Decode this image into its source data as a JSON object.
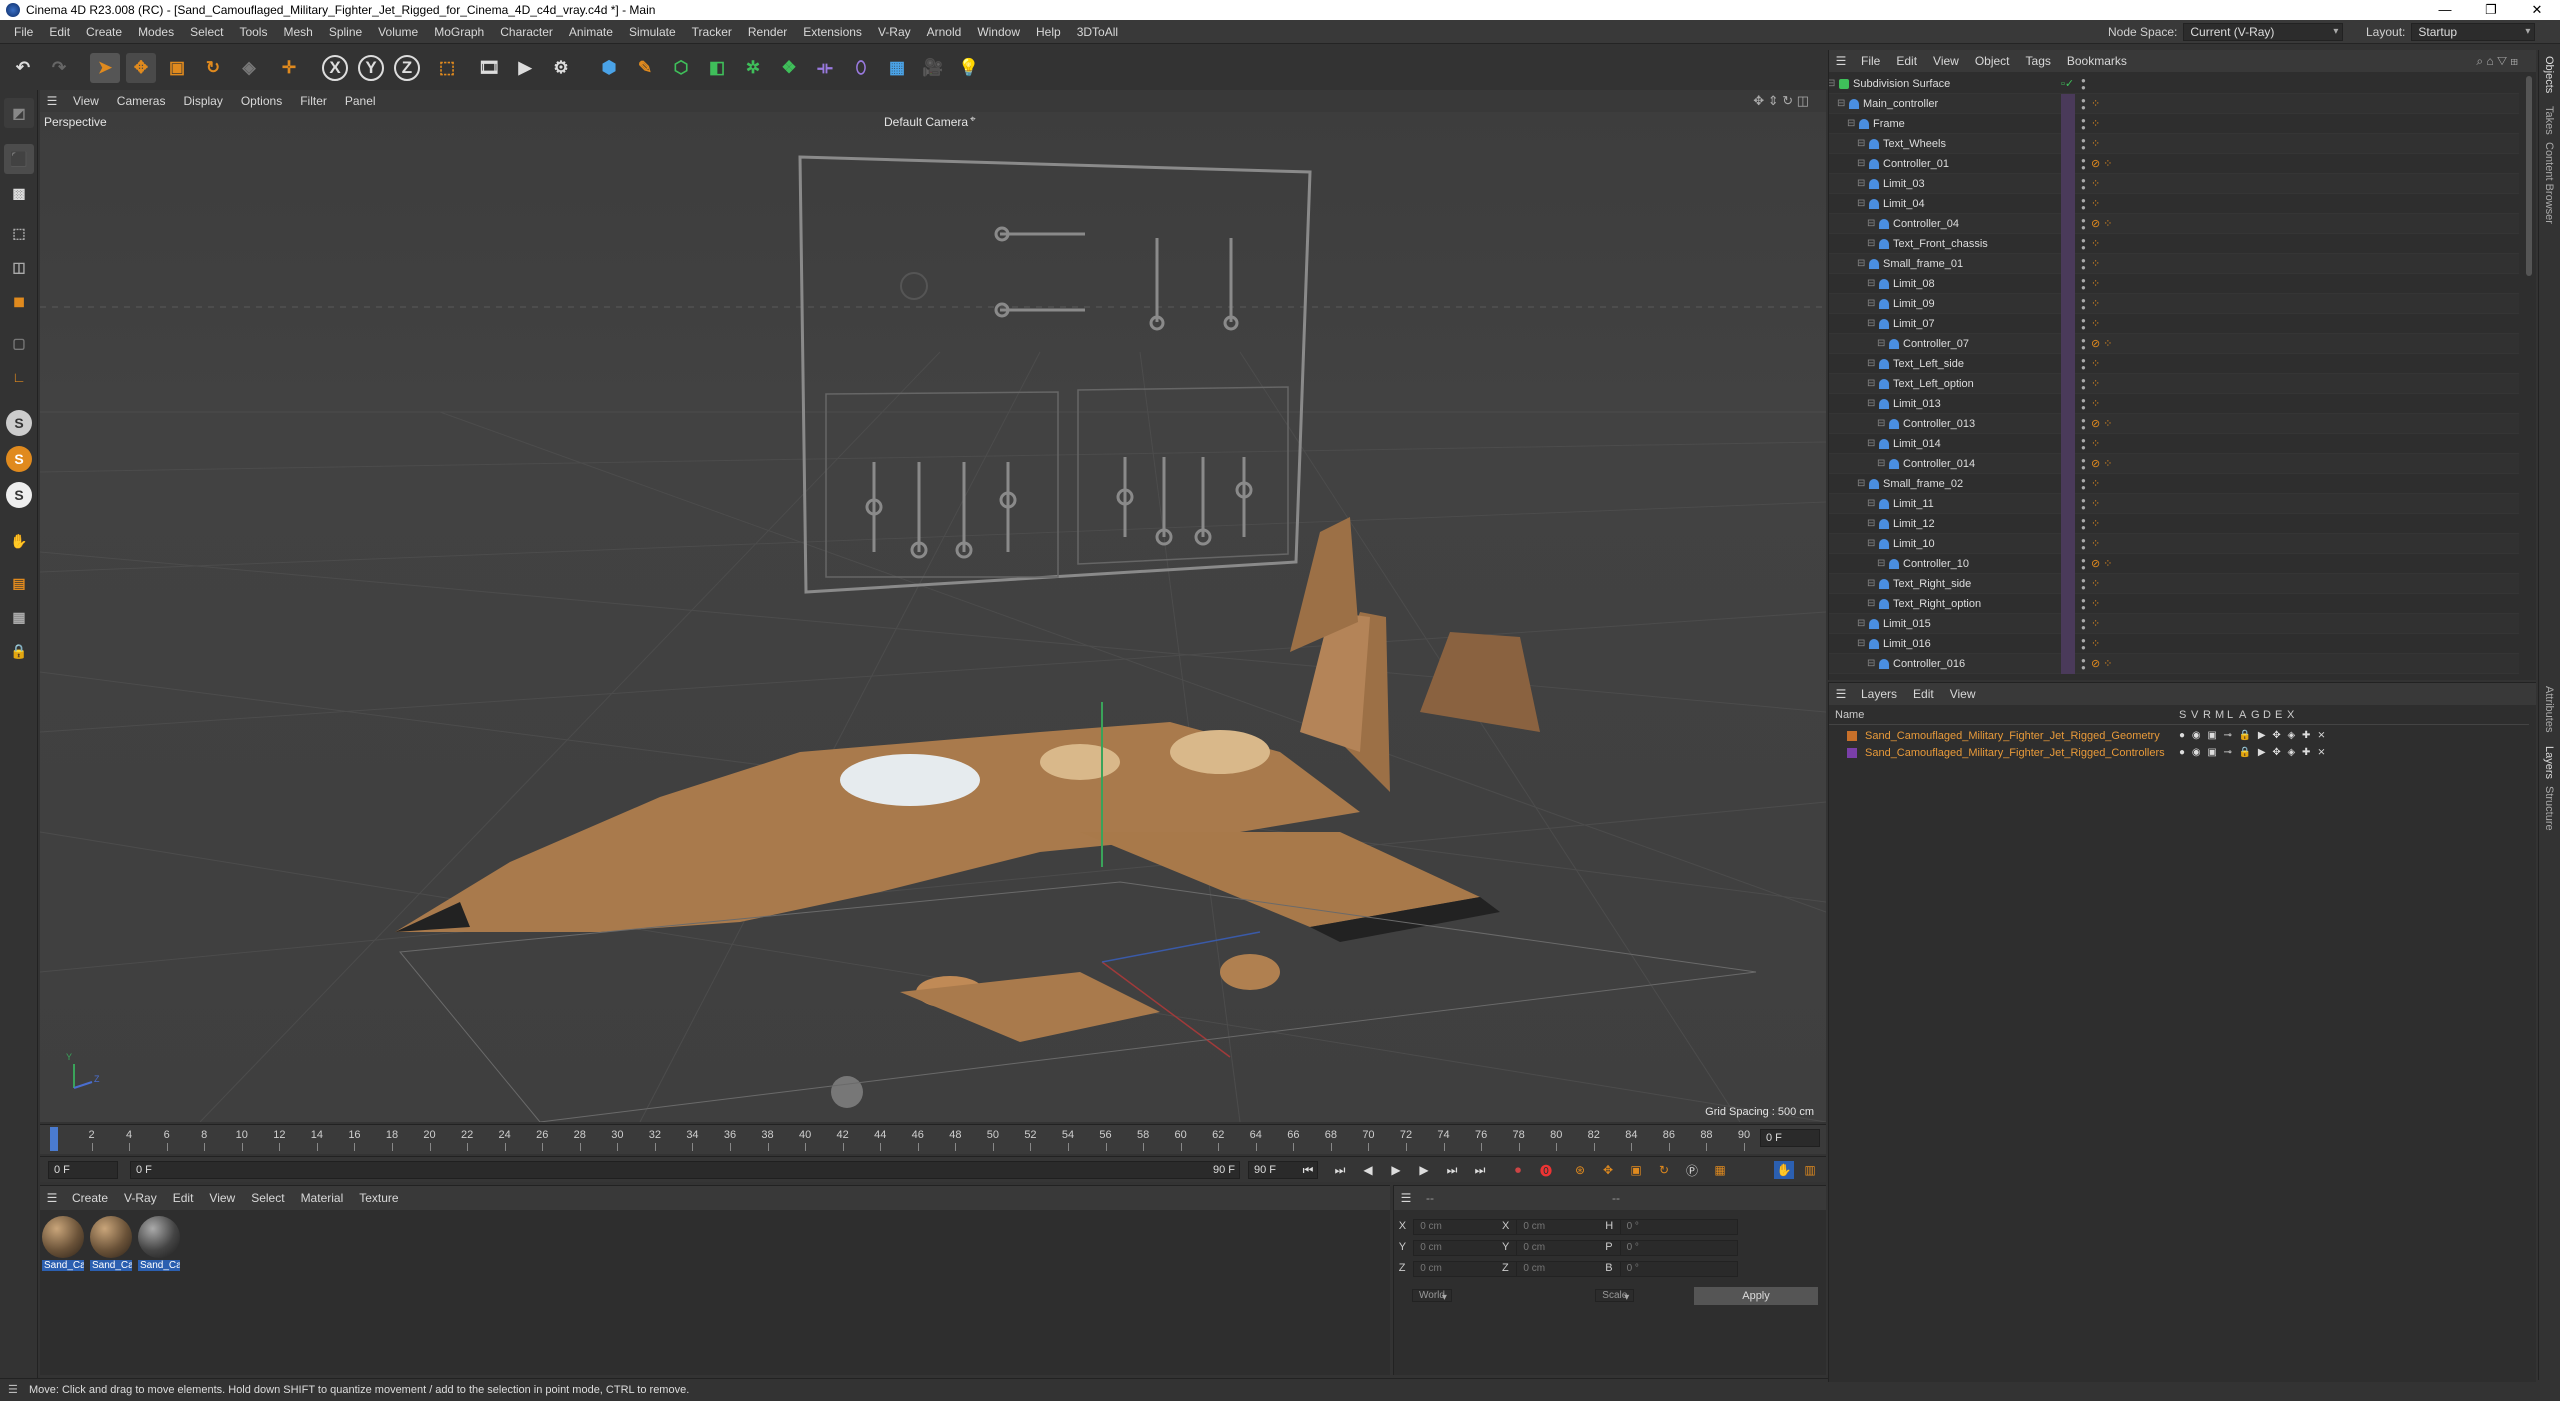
{
  "window": {
    "title": "Cinema 4D R23.008 (RC) - [Sand_Camouflaged_Military_Fighter_Jet_Rigged_for_Cinema_4D_c4d_vray.c4d *] - Main",
    "minimize": "—",
    "maximize": "❐",
    "close": "✕"
  },
  "menu": [
    "File",
    "Edit",
    "Create",
    "Modes",
    "Select",
    "Tools",
    "Mesh",
    "Spline",
    "Volume",
    "MoGraph",
    "Character",
    "Animate",
    "Simulate",
    "Tracker",
    "Render",
    "Extensions",
    "V-Ray",
    "Arnold",
    "Window",
    "Help",
    "3DToAll"
  ],
  "node_space": {
    "label": "Node Space:",
    "value": "Current (V-Ray)"
  },
  "layout": {
    "label": "Layout:",
    "value": "Startup"
  },
  "toolbar": {
    "x": "X",
    "y": "Y",
    "z": "Z"
  },
  "lefttools": {
    "s1": "S",
    "s2": "S",
    "s3": "S"
  },
  "viewport": {
    "menu": [
      "View",
      "Cameras",
      "Display",
      "Options",
      "Filter",
      "Panel"
    ],
    "projection": "Perspective",
    "camera": "Default Camera",
    "camera_icon": "camera-target-icon",
    "grid_spacing": "Grid Spacing : 500 cm",
    "axis_y": "Y",
    "axis_z": "Z"
  },
  "timeline": {
    "ticks": [
      "0",
      "2",
      "4",
      "6",
      "8",
      "10",
      "12",
      "14",
      "16",
      "18",
      "20",
      "22",
      "24",
      "26",
      "28",
      "30",
      "32",
      "34",
      "36",
      "38",
      "40",
      "42",
      "44",
      "46",
      "48",
      "50",
      "52",
      "54",
      "56",
      "58",
      "60",
      "62",
      "64",
      "66",
      "68",
      "70",
      "72",
      "74",
      "76",
      "78",
      "80",
      "82",
      "84",
      "86",
      "88",
      "90"
    ],
    "current": "0 F",
    "start": "0 F",
    "preview_start": "0 F",
    "preview_end": "90 F",
    "end": "90 F"
  },
  "materials": {
    "menu": [
      "Create",
      "V-Ray",
      "Edit",
      "View",
      "Select",
      "Material",
      "Texture"
    ],
    "items": [
      "Sand_Ca",
      "Sand_Ca",
      "Sand_Ca"
    ]
  },
  "coordinates": {
    "rows": [
      {
        "a": "X",
        "av": "0 cm",
        "b": "X",
        "bv": "0 cm",
        "c": "H",
        "cv": "0 °"
      },
      {
        "a": "Y",
        "av": "0 cm",
        "b": "Y",
        "bv": "0 cm",
        "c": "P",
        "cv": "0 °"
      },
      {
        "a": "Z",
        "av": "0 cm",
        "b": "Z",
        "bv": "0 cm",
        "c": "B",
        "cv": "0 °"
      }
    ],
    "space": "World",
    "mode": "Scale",
    "apply": "Apply",
    "header_left": "--",
    "header_right": "--"
  },
  "status": "Move: Click and drag to move elements. Hold down SHIFT to quantize movement / add to the selection in point mode, CTRL to remove.",
  "objects": {
    "menu": [
      "File",
      "Edit",
      "View",
      "Object",
      "Tags",
      "Bookmarks"
    ],
    "rows": [
      {
        "name": "Subdivision Surface",
        "level": 0,
        "type": "subdiv"
      },
      {
        "name": "Main_controller",
        "level": 1,
        "type": "bone"
      },
      {
        "name": "Frame",
        "level": 2,
        "type": "bone"
      },
      {
        "name": "Text_Wheels",
        "level": 3,
        "type": "bone"
      },
      {
        "name": "Controller_01",
        "level": 3,
        "type": "bone",
        "ctrl": true
      },
      {
        "name": "Limit_03",
        "level": 3,
        "type": "bone"
      },
      {
        "name": "Limit_04",
        "level": 3,
        "type": "bone"
      },
      {
        "name": "Controller_04",
        "level": 4,
        "type": "bone",
        "ctrl": true
      },
      {
        "name": "Text_Front_chassis",
        "level": 4,
        "type": "bone"
      },
      {
        "name": "Small_frame_01",
        "level": 3,
        "type": "bone"
      },
      {
        "name": "Limit_08",
        "level": 4,
        "type": "bone"
      },
      {
        "name": "Limit_09",
        "level": 4,
        "type": "bone"
      },
      {
        "name": "Limit_07",
        "level": 4,
        "type": "bone"
      },
      {
        "name": "Controller_07",
        "level": 5,
        "type": "bone",
        "ctrl": true
      },
      {
        "name": "Text_Left_side",
        "level": 4,
        "type": "bone"
      },
      {
        "name": "Text_Left_option",
        "level": 4,
        "type": "bone"
      },
      {
        "name": "Limit_013",
        "level": 4,
        "type": "bone"
      },
      {
        "name": "Controller_013",
        "level": 5,
        "type": "bone",
        "ctrl": true
      },
      {
        "name": "Limit_014",
        "level": 4,
        "type": "bone"
      },
      {
        "name": "Controller_014",
        "level": 5,
        "type": "bone",
        "ctrl": true
      },
      {
        "name": "Small_frame_02",
        "level": 3,
        "type": "bone"
      },
      {
        "name": "Limit_11",
        "level": 4,
        "type": "bone"
      },
      {
        "name": "Limit_12",
        "level": 4,
        "type": "bone"
      },
      {
        "name": "Limit_10",
        "level": 4,
        "type": "bone"
      },
      {
        "name": "Controller_10",
        "level": 5,
        "type": "bone",
        "ctrl": true
      },
      {
        "name": "Text_Right_side",
        "level": 4,
        "type": "bone"
      },
      {
        "name": "Text_Right_option",
        "level": 4,
        "type": "bone"
      },
      {
        "name": "Limit_015",
        "level": 3,
        "type": "bone"
      },
      {
        "name": "Limit_016",
        "level": 3,
        "type": "bone"
      },
      {
        "name": "Controller_016",
        "level": 4,
        "type": "bone",
        "ctrl": true
      }
    ]
  },
  "layers": {
    "menu": [
      "Layers",
      "Edit",
      "View"
    ],
    "header": {
      "name": "Name",
      "cols": [
        "S",
        "V",
        "R",
        "M",
        "L",
        "A",
        "G",
        "D",
        "E",
        "X"
      ]
    },
    "rows": [
      {
        "name": "Sand_Camouflaged_Military_Fighter_Jet_Rigged_Geometry",
        "color": "#c8702a"
      },
      {
        "name": "Sand_Camouflaged_Military_Fighter_Jet_Rigged_Controllers",
        "color": "#7a3fa8"
      }
    ]
  },
  "sidetabs": [
    "Objects",
    "Takes",
    "Content Browser",
    "Attributes",
    "Layers",
    "Structure"
  ],
  "colors": {
    "accent": "#e08a1e",
    "selection_blue": "#2b5fb0",
    "layer_text": "#e89a3a"
  }
}
